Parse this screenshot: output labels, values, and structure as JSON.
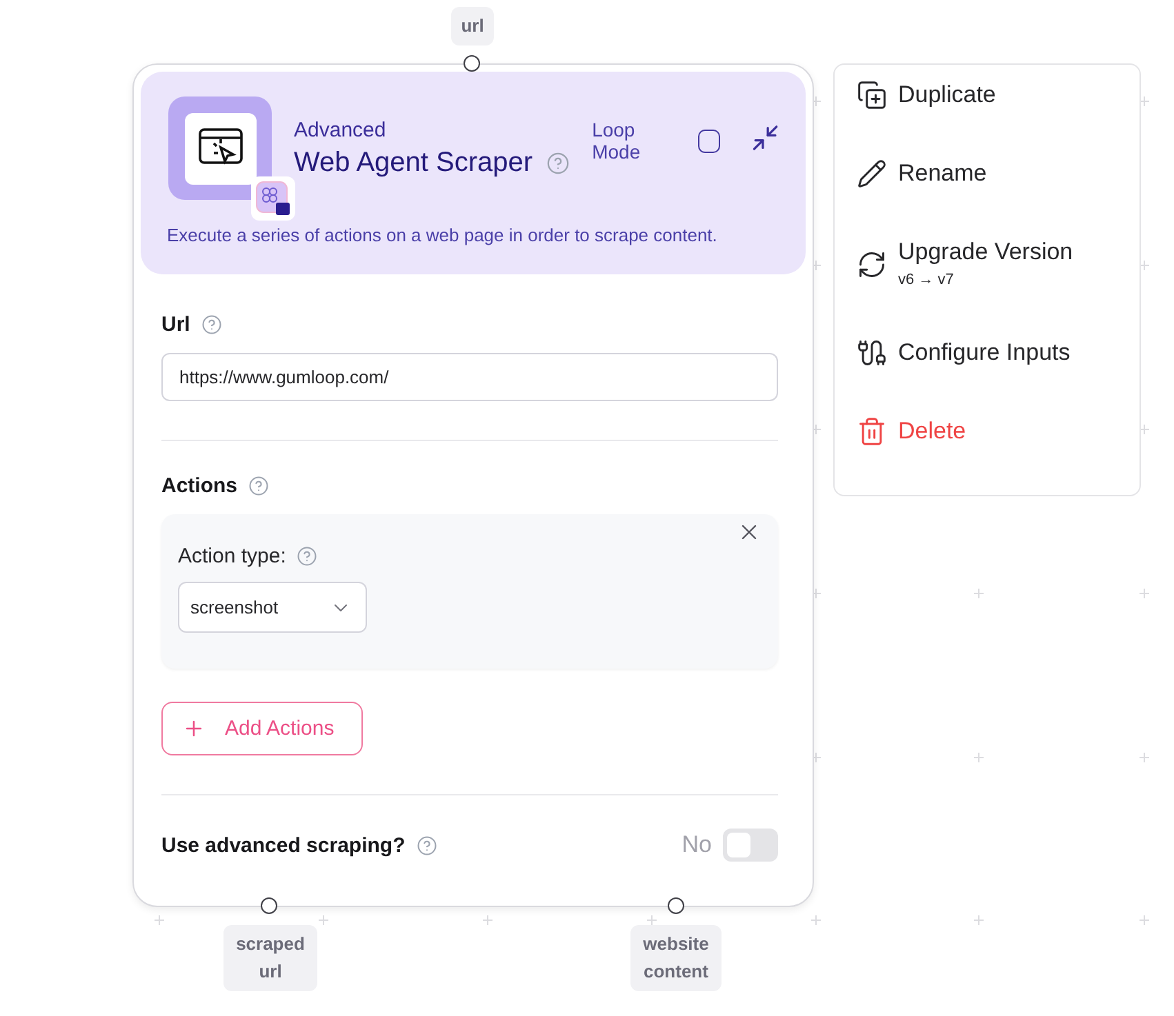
{
  "node": {
    "inputs": [
      {
        "label": "url"
      }
    ],
    "category": "Advanced",
    "title": "Web Agent Scraper",
    "loop_mode": {
      "label": "Loop Mode",
      "checked": false
    },
    "description": "Execute a series of actions on a web page in order to scrape content.",
    "url_field": {
      "label": "Url",
      "value": "https://www.gumloop.com/"
    },
    "actions": {
      "label": "Actions",
      "items": [
        {
          "label": "Action type:",
          "value": "screenshot"
        }
      ],
      "add_button": "Add Actions"
    },
    "advanced": {
      "label": "Use advanced scraping?",
      "state_text": "No",
      "on": false
    },
    "outputs": [
      {
        "label": "scraped url"
      },
      {
        "label": "website content"
      }
    ]
  },
  "menu": {
    "items": [
      {
        "kind": "duplicate",
        "label": "Duplicate"
      },
      {
        "kind": "rename",
        "label": "Rename"
      },
      {
        "kind": "upgrade",
        "label": "Upgrade Version",
        "sublabel": "v6 → v7"
      },
      {
        "kind": "configure",
        "label": "Configure Inputs"
      },
      {
        "kind": "delete",
        "label": "Delete"
      }
    ]
  }
}
